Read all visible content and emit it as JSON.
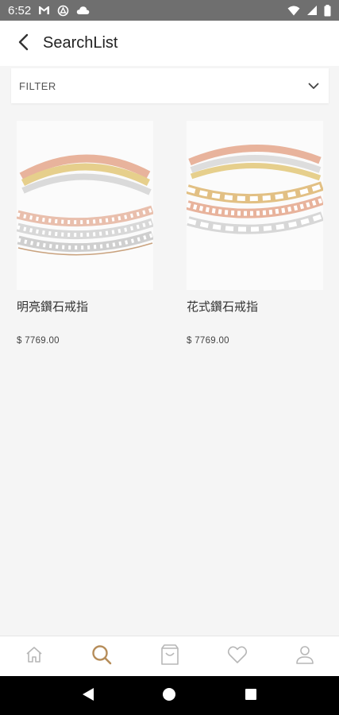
{
  "status_bar": {
    "time": "6:52",
    "icons_left": [
      "gmail-icon",
      "vpn-icon",
      "cloud-icon"
    ],
    "icons_right": [
      "wifi-icon",
      "signal-icon",
      "battery-icon"
    ]
  },
  "header": {
    "title": "SearchList",
    "back_icon": "chevron-left-icon"
  },
  "filter": {
    "label": "FILTER",
    "icon": "chevron-down-icon"
  },
  "products": [
    {
      "name": "明亮鑽石戒指",
      "price": "$ 7769.00",
      "image": "stacked-diamond-rings"
    },
    {
      "name": "花式鑽石戒指",
      "price": "$ 7769.00",
      "image": "stacked-fancy-diamond-rings"
    }
  ],
  "bottom_nav": {
    "items": [
      {
        "icon": "home-icon",
        "active": false
      },
      {
        "icon": "search-icon",
        "active": true
      },
      {
        "icon": "shopping-bag-icon",
        "active": false
      },
      {
        "icon": "heart-icon",
        "active": false
      },
      {
        "icon": "user-icon",
        "active": false
      }
    ],
    "active_color": "#b68d5a",
    "inactive_color": "#b7b7b7"
  },
  "colors": {
    "status_bar_bg": "#6f6f6f",
    "page_bg": "#f5f5f5",
    "rose_gold": "#e8b39c",
    "yellow_gold": "#e6cf8c",
    "white_gold": "#d9d9d9"
  }
}
